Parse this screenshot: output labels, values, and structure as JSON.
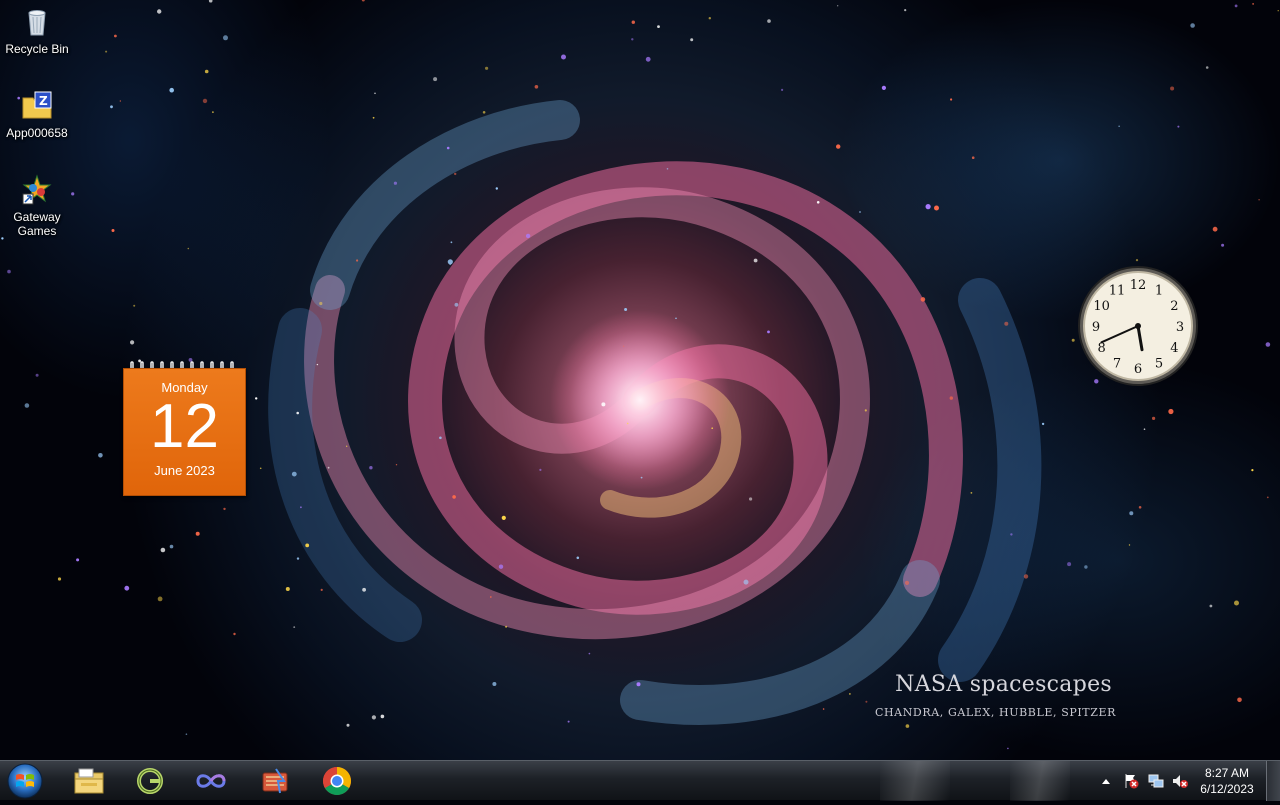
{
  "desktop": {
    "icons": [
      {
        "label": "Recycle Bin",
        "icon": "recycle-bin-icon"
      },
      {
        "label": "App000658",
        "icon": "folder-zip-icon"
      },
      {
        "label": "Gateway\nGames",
        "icon": "gateway-games-icon"
      }
    ]
  },
  "wallpaper": {
    "title": "NASA spacescapes",
    "subtitle": "CHANDRA, GALEX, HUBBLE, SPITZER"
  },
  "calendar_gadget": {
    "weekday": "Monday",
    "day": "12",
    "month_year": "June 2023",
    "color": "#ed7a1c"
  },
  "clock_gadget": {
    "time": "5:41",
    "numerals": [
      "12",
      "1",
      "2",
      "3",
      "4",
      "5",
      "6",
      "7",
      "8",
      "9",
      "10",
      "11"
    ]
  },
  "taskbar": {
    "pinned": [
      {
        "name": "windows-explorer",
        "icon": "folder-icon"
      },
      {
        "name": "gateway-app",
        "icon": "g-logo-icon"
      },
      {
        "name": "infinity-app",
        "icon": "infinity-icon"
      },
      {
        "name": "media-app",
        "icon": "media-icon"
      },
      {
        "name": "chrome",
        "icon": "chrome-icon"
      }
    ],
    "tray": {
      "show_hidden_icon": "up-arrow-icon",
      "icons": [
        "action-center-flag-icon",
        "network-icon",
        "volume-muted-icon"
      ],
      "time": "8:27 AM",
      "date": "6/12/2023"
    }
  }
}
